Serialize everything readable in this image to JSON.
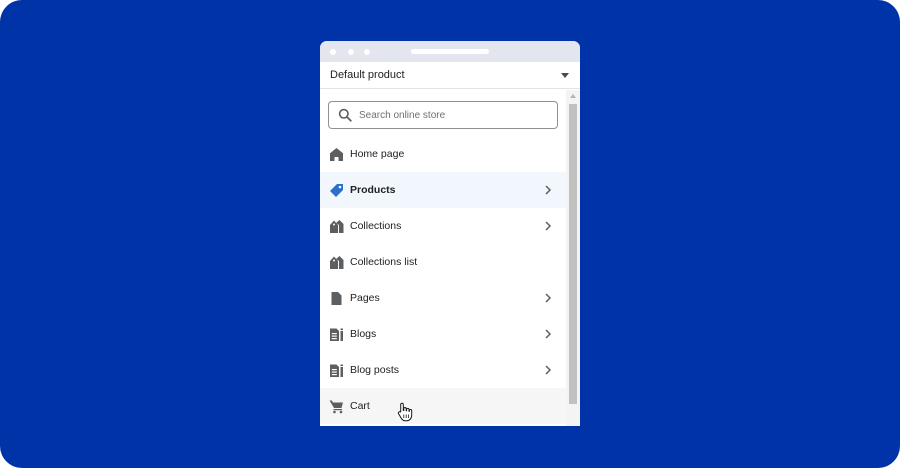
{
  "window": {
    "template_selector": {
      "label": "Default product"
    }
  },
  "search": {
    "placeholder": "Search online store"
  },
  "nav": {
    "items": [
      {
        "label": "Home page",
        "icon": "home-icon",
        "has_chevron": false
      },
      {
        "label": "Products",
        "icon": "tag-icon",
        "has_chevron": true,
        "active": true
      },
      {
        "label": "Collections",
        "icon": "collection-icon",
        "has_chevron": true
      },
      {
        "label": "Collections list",
        "icon": "collection-icon",
        "has_chevron": false
      },
      {
        "label": "Pages",
        "icon": "page-icon",
        "has_chevron": true
      },
      {
        "label": "Blogs",
        "icon": "blog-icon",
        "has_chevron": true
      },
      {
        "label": "Blog posts",
        "icon": "blog-icon",
        "has_chevron": true
      },
      {
        "label": "Cart",
        "icon": "cart-icon",
        "has_chevron": false,
        "hovered": true
      }
    ]
  },
  "colors": {
    "background": "#0033a8",
    "active_icon": "#2c6ecb",
    "icon": "#5c5f62"
  }
}
